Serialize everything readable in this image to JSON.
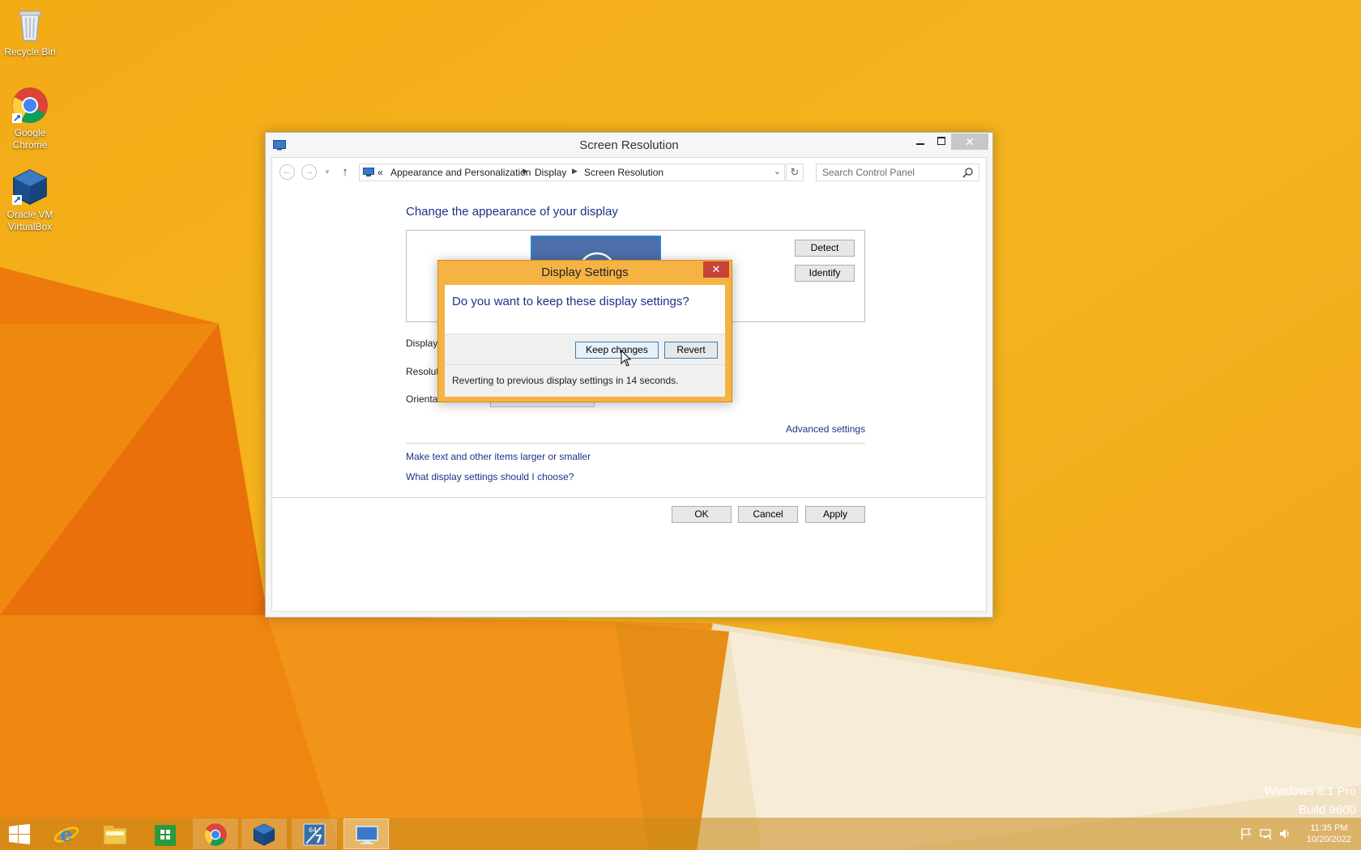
{
  "desktop": {
    "icons": [
      {
        "label": "Recycle Bin",
        "icon": "recycle-bin-icon"
      },
      {
        "label": "Google Chrome",
        "line1": "Google",
        "line2": "Chrome",
        "icon": "chrome-icon"
      },
      {
        "label": "Oracle VM VirtualBox",
        "line1": "Oracle VM",
        "line2": "VirtualBox",
        "icon": "virtualbox-icon"
      }
    ],
    "watermark": {
      "line1": "Windows 8.1 Pro",
      "line2": "Build 9600"
    }
  },
  "window": {
    "title": "Screen Resolution",
    "breadcrumb": [
      "«",
      "Appearance and Personalization",
      "Display",
      "Screen Resolution"
    ],
    "search_placeholder": "Search Control Panel",
    "heading": "Change the appearance of your display",
    "buttons": {
      "detect": "Detect",
      "identify": "Identify",
      "ok": "OK",
      "cancel": "Cancel",
      "apply": "Apply"
    },
    "rows": {
      "display": "Display:",
      "resolution": "Resolution:",
      "orientation": "Orientation:"
    },
    "links": {
      "advanced": "Advanced settings",
      "text_size": "Make text and other items larger or smaller",
      "which_settings": "What display settings should I choose?"
    }
  },
  "dialog": {
    "title": "Display Settings",
    "question": "Do you want to keep these display settings?",
    "keep_label": "Keep changes",
    "revert_label": "Revert",
    "countdown_text": "Reverting to previous display settings in 14 seconds."
  },
  "taskbar": {
    "items": [
      "start-icon",
      "internet-explorer-icon",
      "file-explorer-icon",
      "store-icon",
      "chrome-icon",
      "virtualbox-icon",
      "app-64-7-icon",
      "screen-resolution-icon"
    ],
    "tray": [
      "action-center-flag-icon",
      "network-icon",
      "volume-icon"
    ],
    "time": "11:35 PM",
    "date": "10/20/2022"
  },
  "colors": {
    "wallpaper": "#f0a81a",
    "link": "#1e3287",
    "dialog_frame": "#f5b343",
    "close_red": "#c7423a"
  }
}
